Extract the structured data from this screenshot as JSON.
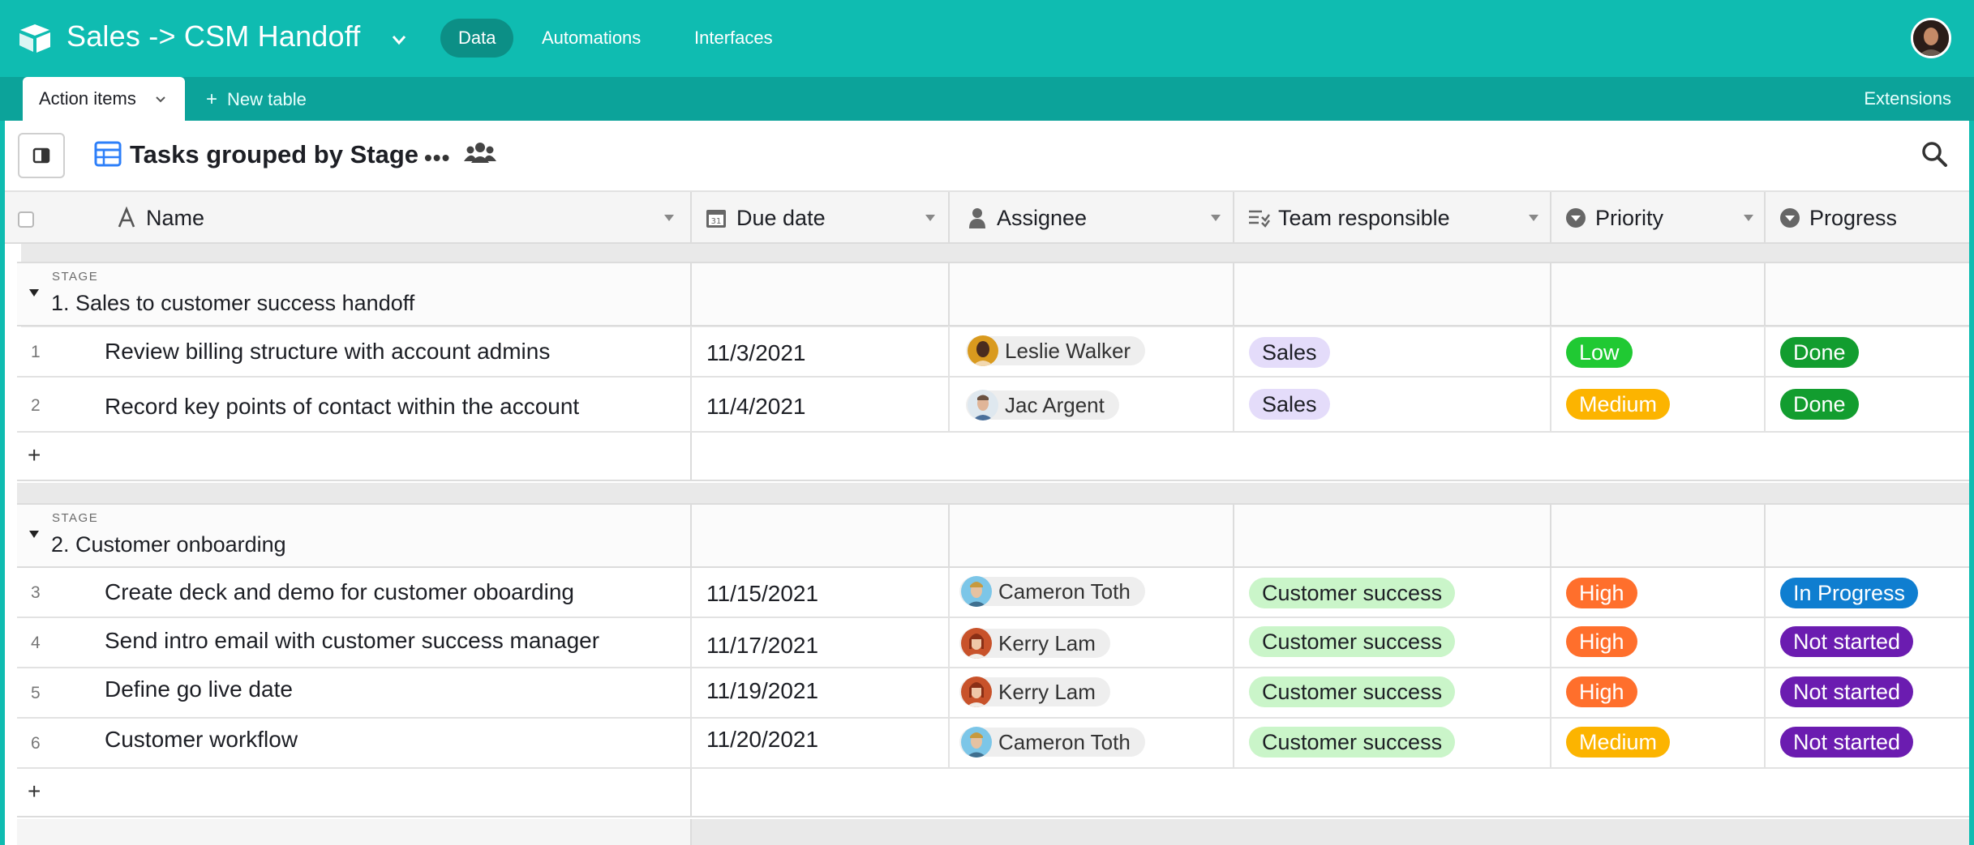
{
  "app": {
    "base_title": "Sales -> CSM Handoff",
    "nav": [
      "Data",
      "Automations",
      "Interfaces"
    ],
    "active_nav": "Data"
  },
  "tabs": {
    "active": "Action items",
    "new_table": "New table",
    "extensions": "Extensions"
  },
  "view": {
    "title": "Tasks grouped by Stage"
  },
  "columns": {
    "name": "Name",
    "due_date": "Due date",
    "assignee": "Assignee",
    "team": "Team responsible",
    "priority": "Priority",
    "progress": "Progress"
  },
  "groups": [
    {
      "label": "STAGE",
      "name": "1. Sales to customer success handoff",
      "rows": [
        {
          "num": "1",
          "name": "Review billing structure with account admins",
          "due": "11/3/2021",
          "assignee": "Leslie Walker",
          "team": "Sales",
          "priority": "Low",
          "progress": "Done"
        },
        {
          "num": "2",
          "name": "Record key points of contact within the account",
          "due": "11/4/2021",
          "assignee": "Jac Argent",
          "team": "Sales",
          "priority": "Medium",
          "progress": "Done"
        }
      ]
    },
    {
      "label": "STAGE",
      "name": "2. Customer onboarding",
      "rows": [
        {
          "num": "3",
          "name": "Create deck and demo for customer oboarding",
          "due": "11/15/2021",
          "assignee": "Cameron Toth",
          "team": "Customer success",
          "priority": "High",
          "progress": "In Progress"
        },
        {
          "num": "4",
          "name": "Send intro email with customer success manager",
          "due": "11/17/2021",
          "assignee": "Kerry Lam",
          "team": "Customer success",
          "priority": "High",
          "progress": "Not started"
        },
        {
          "num": "5",
          "name": "Define go live date",
          "due": "11/19/2021",
          "assignee": "Kerry Lam",
          "team": "Customer success",
          "priority": "High",
          "progress": "Not started"
        },
        {
          "num": "6",
          "name": "Customer workflow",
          "due": "11/20/2021",
          "assignee": "Cameron Toth",
          "team": "Customer success",
          "priority": "Medium",
          "progress": "Not started"
        }
      ]
    }
  ],
  "add_row_symbol": "+",
  "colors": {
    "header": "#0fbcb1",
    "tabstrip": "#0ca39a",
    "sales": "#e4dcfa",
    "customer_success": "#caf5c9",
    "low": "#20c933",
    "medium": "#fcb400",
    "high": "#ff6f2c",
    "done": "#129d2f",
    "in_progress": "#0f7ed0",
    "not_started": "#6b1cb0"
  }
}
